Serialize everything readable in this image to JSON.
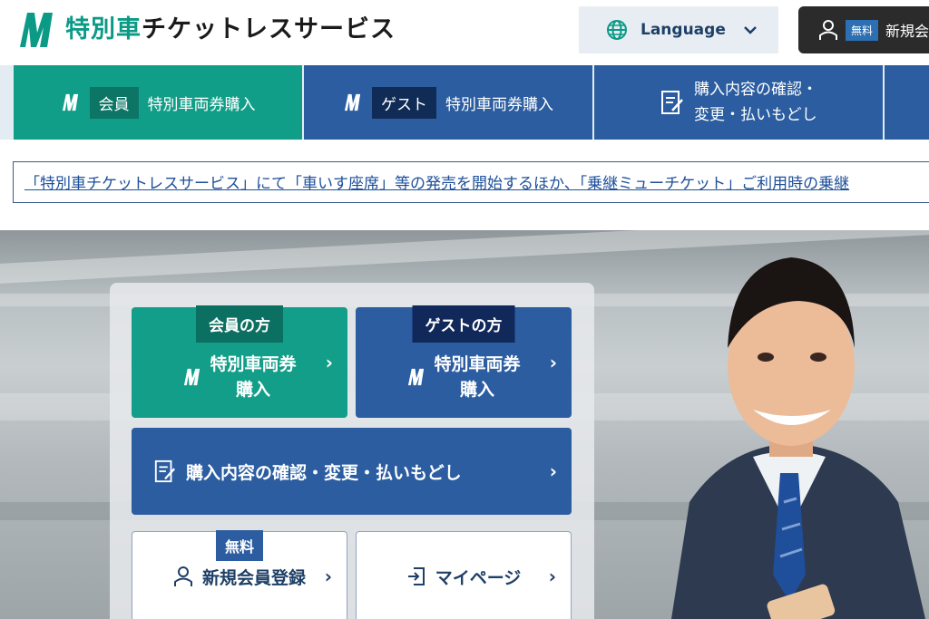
{
  "header": {
    "logo_brand": "特別車",
    "logo_rest": "チケットレスサービス",
    "language_label": "Language",
    "signup_badge": "無料",
    "signup_label": "新規会員"
  },
  "nav": {
    "tab1_tag": "会員",
    "tab1_label": "特別車両券購入",
    "tab2_tag": "ゲスト",
    "tab2_label": "特別車両券購入",
    "tab3_line1": "購入内容の確認・",
    "tab3_line2": "変更・払いもどし"
  },
  "notice": {
    "text": "「特別車チケットレスサービス」にて「車いす座席」等の発売を開始するほか、「乗継ミューチケット」ご利用時の乗継"
  },
  "hero": {
    "member_tab": "会員の方",
    "member_line1": "特別車両券",
    "member_line2": "購入",
    "guest_tab": "ゲストの方",
    "guest_line1": "特別車両券",
    "guest_line2": "購入",
    "confirm_label": "購入内容の確認・変更・払いもどし",
    "signup_tab": "無料",
    "signup_label": "新規会員登録",
    "mypage_label": "マイページ"
  },
  "colors": {
    "green": "#119e88",
    "blue": "#2b5da0",
    "dark_navy": "#102b56"
  }
}
